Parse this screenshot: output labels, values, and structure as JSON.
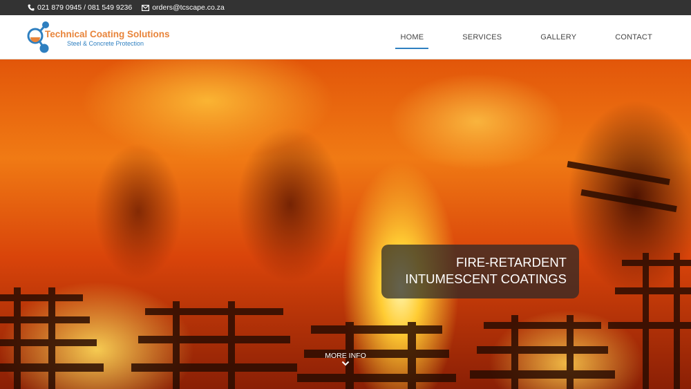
{
  "topbar": {
    "phone": "021 879 0945 / 081 549 9236",
    "email": "orders@tcscape.co.za",
    "phone_icon": "phone-icon",
    "email_icon": "envelope-icon"
  },
  "header": {
    "logo_title": "Technical Coating Solutions",
    "logo_subtitle": "Steel & Concrete Protection",
    "nav": [
      {
        "label": "HOME",
        "active": true
      },
      {
        "label": "SERVICES",
        "active": false
      },
      {
        "label": "GALLERY",
        "active": false
      },
      {
        "label": "CONTACT",
        "active": false
      }
    ]
  },
  "hero": {
    "caption_line1": "FIRE-RETARDENT",
    "caption_line2": "INTUMESCENT COATINGS",
    "more_info": "MORE INFO",
    "more_icon": "chevron-down-icon"
  },
  "colors": {
    "brand_orange": "#e8843a",
    "brand_blue": "#2e7fc0",
    "topbar_bg": "#333333"
  }
}
